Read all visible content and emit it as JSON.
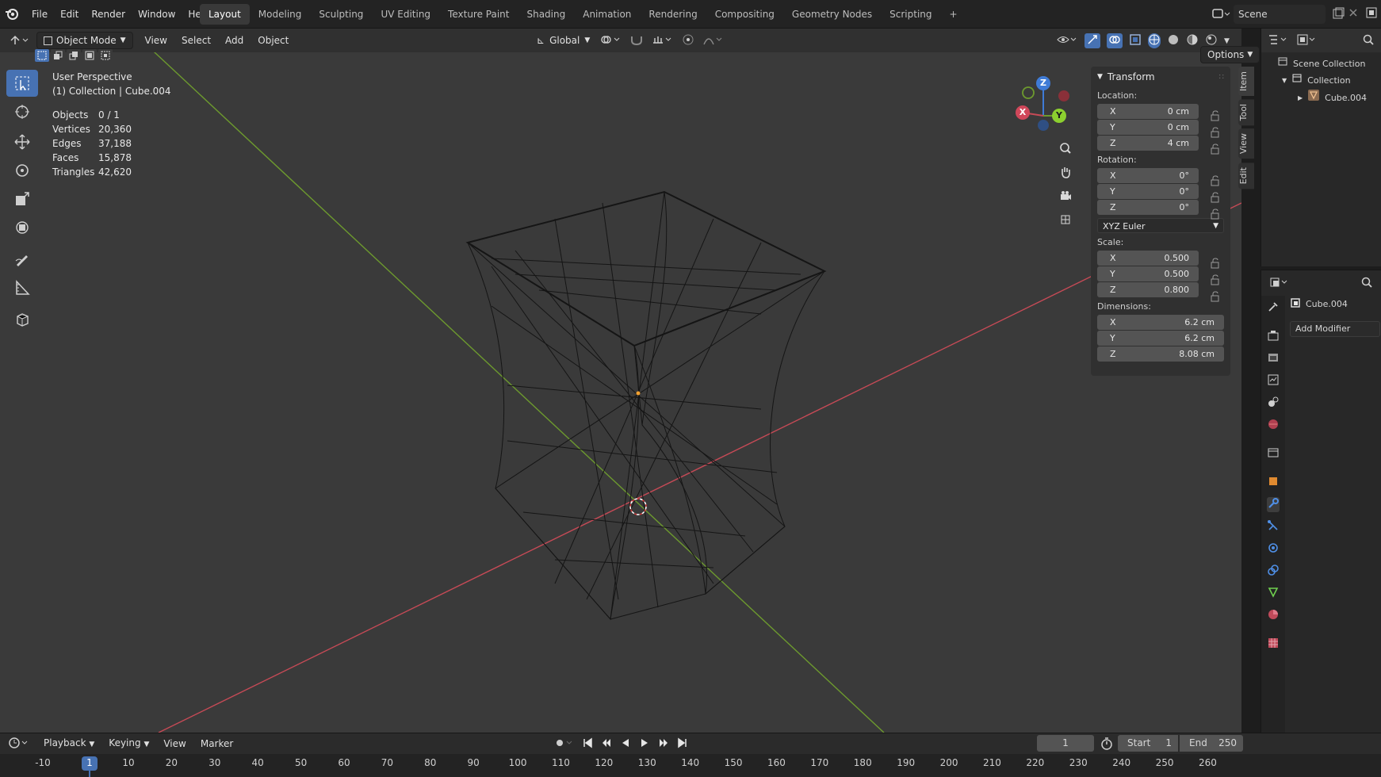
{
  "menu": {
    "items": [
      "File",
      "Edit",
      "Render",
      "Window",
      "Help"
    ]
  },
  "workspaces": [
    "Layout",
    "Modeling",
    "Sculpting",
    "UV Editing",
    "Texture Paint",
    "Shading",
    "Animation",
    "Rendering",
    "Compositing",
    "Geometry Nodes",
    "Scripting"
  ],
  "add_workspace": "+",
  "scene": {
    "label": "Scene"
  },
  "viewport_header": {
    "mode": "Object Mode",
    "view": "View",
    "select": "Select",
    "add": "Add",
    "object": "Object",
    "orientation": "Global",
    "options": "Options"
  },
  "overlay": {
    "title": "User Perspective",
    "subtitle": "(1) Collection | Cube.004"
  },
  "stats": [
    {
      "label": "Objects",
      "value": "0 / 1"
    },
    {
      "label": "Vertices",
      "value": "20,360"
    },
    {
      "label": "Edges",
      "value": "37,188"
    },
    {
      "label": "Faces",
      "value": "15,878"
    },
    {
      "label": "Triangles",
      "value": "42,620"
    }
  ],
  "transform": {
    "title": "Transform",
    "location_label": "Location:",
    "location": [
      {
        "axis": "X",
        "value": "0 cm"
      },
      {
        "axis": "Y",
        "value": "0 cm"
      },
      {
        "axis": "Z",
        "value": "4 cm"
      }
    ],
    "rotation_label": "Rotation:",
    "rotation": [
      {
        "axis": "X",
        "value": "0°"
      },
      {
        "axis": "Y",
        "value": "0°"
      },
      {
        "axis": "Z",
        "value": "0°"
      }
    ],
    "rotation_mode": "XYZ Euler",
    "scale_label": "Scale:",
    "scale": [
      {
        "axis": "X",
        "value": "0.500"
      },
      {
        "axis": "Y",
        "value": "0.500"
      },
      {
        "axis": "Z",
        "value": "0.800"
      }
    ],
    "dimensions_label": "Dimensions:",
    "dimensions": [
      {
        "axis": "X",
        "value": "6.2 cm"
      },
      {
        "axis": "Y",
        "value": "6.2 cm"
      },
      {
        "axis": "Z",
        "value": "8.08 cm"
      }
    ]
  },
  "sidebar_tabs": [
    "Item",
    "Tool",
    "View",
    "Edit"
  ],
  "gizmo": {
    "z": "Z",
    "y": "Y",
    "x": "X"
  },
  "outliner": {
    "scene_collection": "Scene Collection",
    "collection": "Collection",
    "object": "Cube.004"
  },
  "properties": {
    "object_name": "Cube.004",
    "add_modifier": "Add Modifier"
  },
  "timeline": {
    "playback": "Playback",
    "keying": "Keying",
    "view": "View",
    "marker": "Marker",
    "current_frame": "1",
    "start_label": "Start",
    "start": "1",
    "end_label": "End",
    "end": "250",
    "ruler": [
      "-10",
      "1",
      "10",
      "20",
      "30",
      "40",
      "50",
      "60",
      "70",
      "80",
      "90",
      "100",
      "110",
      "120",
      "130",
      "140",
      "150",
      "160",
      "170",
      "180",
      "190",
      "200",
      "210",
      "220",
      "230",
      "240",
      "250",
      "260"
    ]
  },
  "colors": {
    "accent": "#4772b3",
    "x_axis": "#c64a56",
    "y_axis": "#6d9a2e",
    "z_axis": "#3f7bd6"
  }
}
